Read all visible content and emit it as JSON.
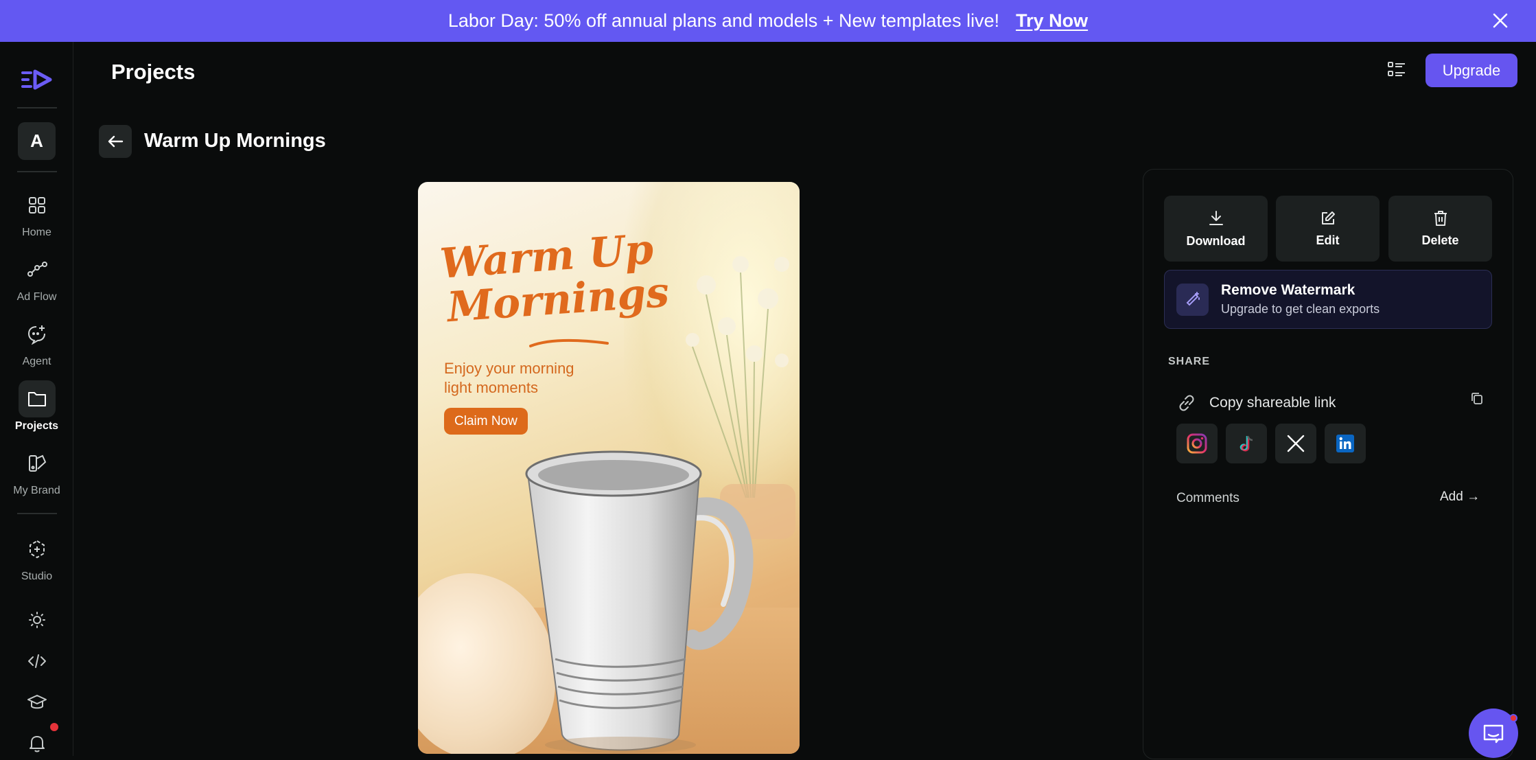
{
  "banner": {
    "text": "Labor Day: 50% off annual plans and models + New templates live!",
    "cta": "Try Now",
    "color": "#6358f2"
  },
  "sidebar": {
    "avatar_letter": "A",
    "items": [
      {
        "label": "Home",
        "icon": "grid-icon"
      },
      {
        "label": "Ad Flow",
        "icon": "flow-icon"
      },
      {
        "label": "Agent",
        "icon": "agent-icon"
      },
      {
        "label": "Projects",
        "icon": "folder-icon",
        "active": true
      },
      {
        "label": "My Brand",
        "icon": "brand-icon"
      },
      {
        "label": "Studio",
        "icon": "studio-icon"
      }
    ],
    "bottom_icons": [
      "sun-icon",
      "code-icon",
      "graduation-cap-icon",
      "bell-icon"
    ]
  },
  "header": {
    "title": "Projects",
    "upgrade_label": "Upgrade",
    "accent": "#6655f0"
  },
  "project": {
    "title": "Warm Up Mornings"
  },
  "preview": {
    "headline_line1": "Warm Up",
    "headline_line2": "Mornings",
    "subline1": "Enjoy your morning",
    "subline2": "light moments",
    "cta": "Claim Now",
    "accent": "#e06a1d"
  },
  "panel": {
    "actions": [
      {
        "label": "Download",
        "icon": "download-icon"
      },
      {
        "label": "Edit",
        "icon": "edit-icon"
      },
      {
        "label": "Delete",
        "icon": "trash-icon"
      }
    ],
    "watermark": {
      "title": "Remove Watermark",
      "subtitle": "Upgrade to get clean exports"
    },
    "share_heading": "SHARE",
    "copy_link_label": "Copy shareable link",
    "socials": [
      "instagram-icon",
      "tiktok-icon",
      "x-icon",
      "linkedin-icon"
    ],
    "comments_label": "Comments",
    "add_label": "Add →"
  }
}
